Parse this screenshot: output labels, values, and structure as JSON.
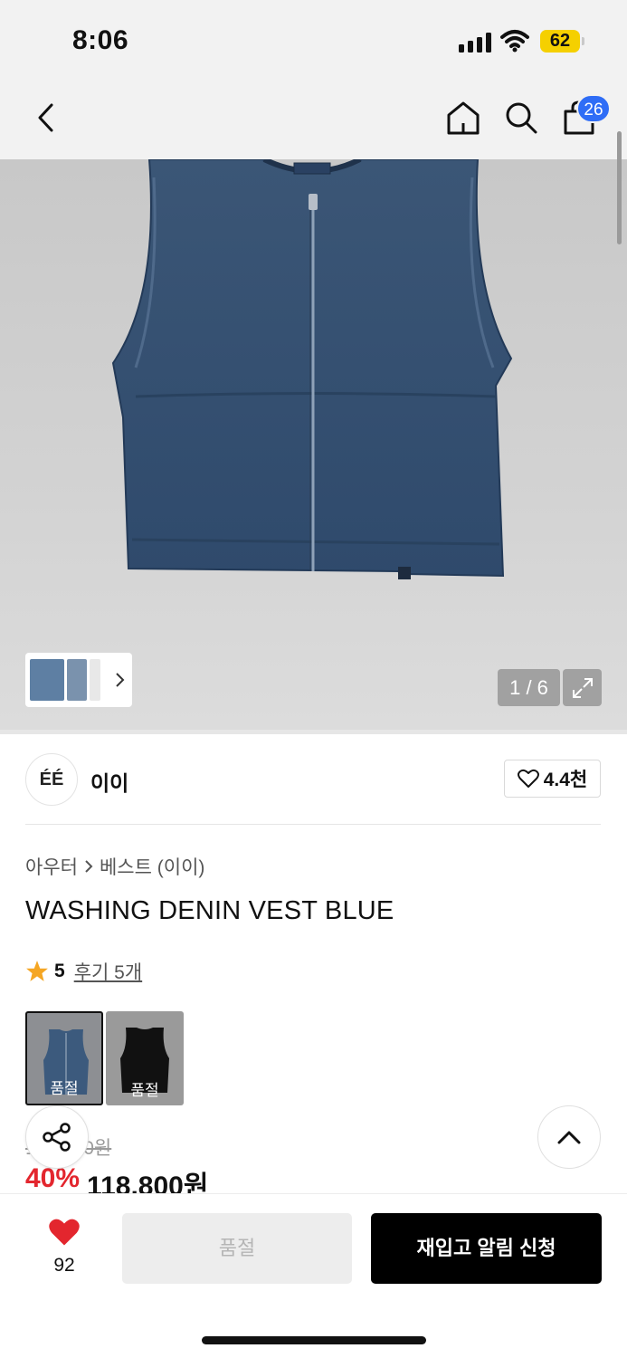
{
  "status_bar": {
    "time": "8:06",
    "battery": "62",
    "battery_color": "#f5d000"
  },
  "nav": {
    "back_icon": "chevron-left-icon",
    "home_icon": "home-icon",
    "search_icon": "search-icon",
    "cart_icon": "shopping-bag-icon",
    "cart_count": "26",
    "badge_color": "#2f6df6"
  },
  "gallery": {
    "pager": "1 / 6",
    "zoom_icon": "expand-icon"
  },
  "brand": {
    "logo_text": "ÉÉ",
    "name": "이이",
    "likes": "4.4천"
  },
  "breadcrumb": {
    "category": "아우터",
    "subcategory": "베스트 (이이)"
  },
  "product": {
    "title": "WASHING DENIN VEST BLUE",
    "rating": "5",
    "reviews": "후기 5개",
    "options": [
      {
        "label": "품절"
      },
      {
        "label": "품절"
      }
    ],
    "original_price": "198,000원",
    "discount_rate": "40%",
    "sale_price": "118,800원",
    "accent_color": "#e3262e"
  },
  "bottom_bar": {
    "wish_count": "92",
    "soldout_label": "품절",
    "restock_label": "재입고 알림 신청"
  }
}
